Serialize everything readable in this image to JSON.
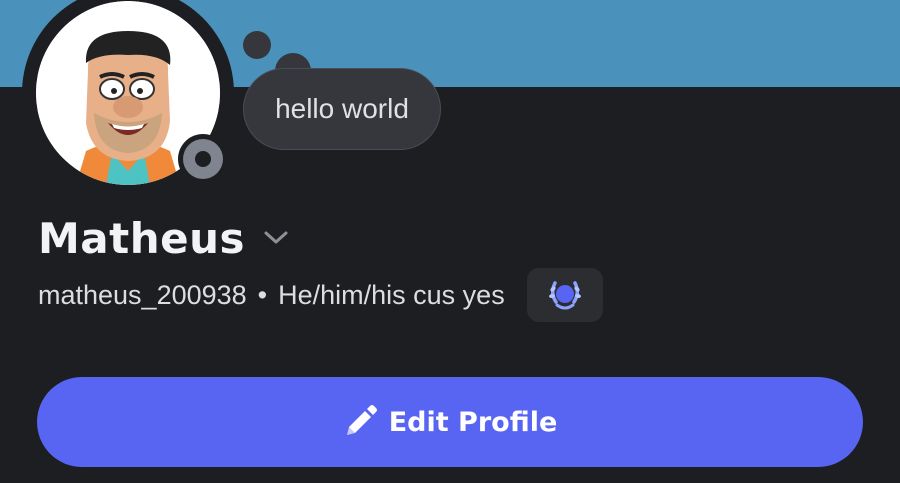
{
  "profile": {
    "display_name": "Matheus",
    "username": "matheus_200938",
    "separator": "•",
    "pronouns": "He/him/his cus yes",
    "custom_status": "hello world",
    "status": "offline"
  },
  "actions": {
    "edit_profile_label": "Edit Profile"
  },
  "colors": {
    "banner": "#4a92bb",
    "background": "#1d1e22",
    "accent": "#5865f2",
    "bubble": "#35373d",
    "status_offline": "#80848e",
    "badge_icon": "#8ba3ff"
  },
  "icons": {
    "chevron": "chevron-down-icon",
    "badge": "laurel-badge-icon",
    "edit": "pencil-icon",
    "status": "offline-status-icon"
  }
}
